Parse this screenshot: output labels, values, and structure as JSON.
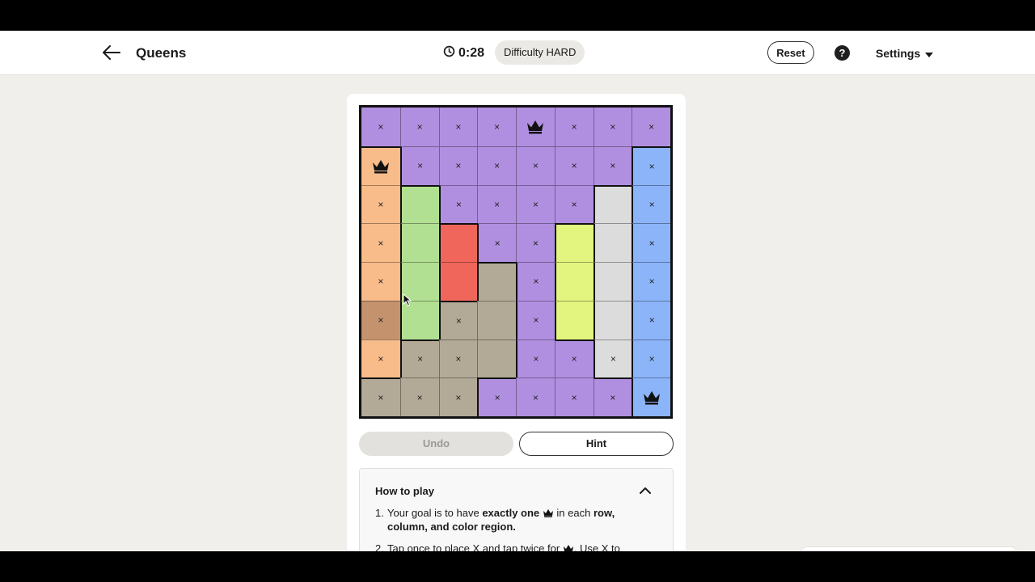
{
  "header": {
    "title": "Queens",
    "timer": "0:28",
    "difficulty": "Difficulty HARD",
    "reset_label": "Reset",
    "help_label": "?",
    "settings_label": "Settings"
  },
  "board": {
    "size": 8,
    "colors": {
      "purple": "#b18fe0",
      "orange": "#f8bc8b",
      "blue": "#8cb4f9",
      "green": "#b2e092",
      "red": "#f0665b",
      "tan": "#b2aa97",
      "yellow": "#e3f57e",
      "gray": "#dcdcdc"
    },
    "regions": [
      [
        "purple",
        "purple",
        "purple",
        "purple",
        "purple",
        "purple",
        "purple",
        "purple"
      ],
      [
        "orange",
        "purple",
        "purple",
        "purple",
        "purple",
        "purple",
        "purple",
        "blue"
      ],
      [
        "orange",
        "green",
        "purple",
        "purple",
        "purple",
        "purple",
        "gray",
        "blue"
      ],
      [
        "orange",
        "green",
        "red",
        "purple",
        "purple",
        "yellow",
        "gray",
        "blue"
      ],
      [
        "orange",
        "green",
        "red",
        "tan",
        "purple",
        "yellow",
        "gray",
        "blue"
      ],
      [
        "orange",
        "green",
        "tan",
        "tan",
        "purple",
        "yellow",
        "gray",
        "blue"
      ],
      [
        "orange",
        "tan",
        "tan",
        "tan",
        "purple",
        "purple",
        "gray",
        "blue"
      ],
      [
        "tan",
        "tan",
        "tan",
        "purple",
        "purple",
        "purple",
        "purple",
        "blue"
      ]
    ],
    "marks": [
      [
        "x",
        "x",
        "x",
        "x",
        "Q",
        "x",
        "x",
        "x"
      ],
      [
        "Q",
        "x",
        "x",
        "x",
        "x",
        "x",
        "x",
        "x"
      ],
      [
        "x",
        "",
        "x",
        "x",
        "x",
        "x",
        "",
        "x"
      ],
      [
        "x",
        "",
        "",
        "x",
        "x",
        "",
        "",
        "x"
      ],
      [
        "x",
        "",
        "",
        "",
        "x",
        "",
        "",
        "x"
      ],
      [
        "x",
        "",
        "x",
        "",
        "x",
        "",
        "",
        "x"
      ],
      [
        "x",
        "x",
        "x",
        "",
        "x",
        "x",
        "x",
        "x"
      ],
      [
        "x",
        "x",
        "x",
        "x",
        "x",
        "x",
        "x",
        "Q"
      ]
    ],
    "x_symbol": "×",
    "hover_cell": [
      5,
      0
    ],
    "hover_color": "#c4926d"
  },
  "controls": {
    "undo_label": "Undo",
    "hint_label": "Hint"
  },
  "how_to_play": {
    "title": "How to play",
    "rule1_prefix": "Your goal is to have ",
    "rule1_bold1": "exactly one",
    "rule1_mid": " in each ",
    "rule1_bold2": "row, column, and color region.",
    "rule2_prefix": "Tap once to place X and tap twice for",
    "rule2_suffix": ". Use X to"
  }
}
